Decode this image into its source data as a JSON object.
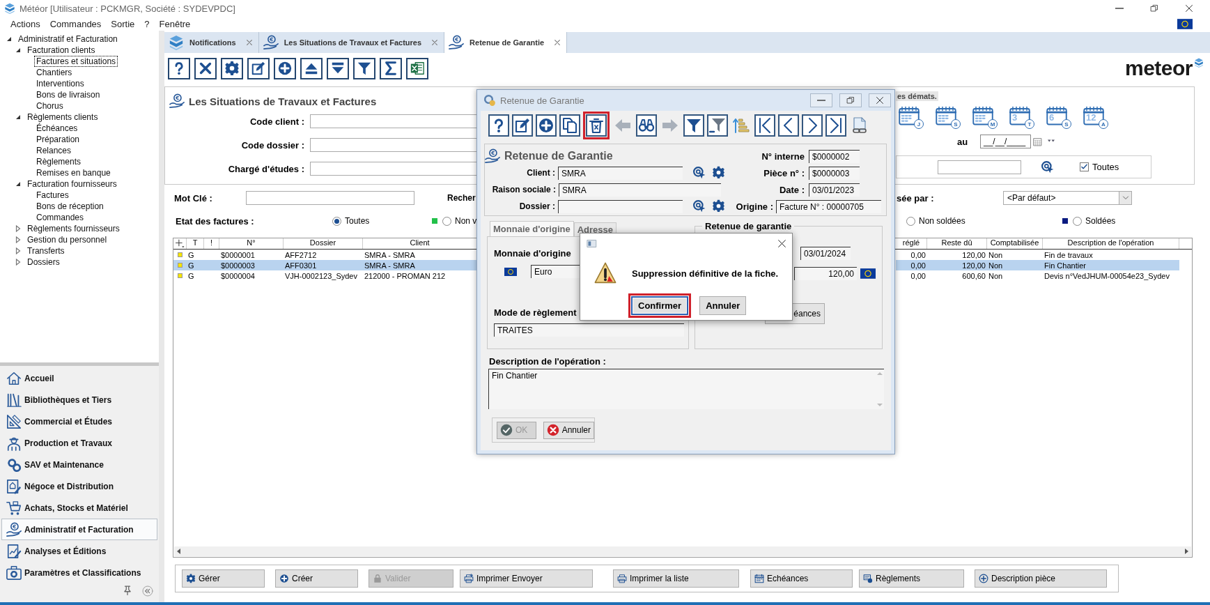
{
  "window": {
    "title": "Météor [Utilisateur : PCKMGR, Société : SYDEVPDC]"
  },
  "menu": [
    {
      "label": "Actions"
    },
    {
      "label": "Commandes"
    },
    {
      "label": "Sortie"
    },
    {
      "label": "?"
    },
    {
      "label": "Fenêtre"
    }
  ],
  "tree": [
    {
      "label": "Administratif et Facturation",
      "selected": false,
      "expanded": true,
      "children": [
        {
          "label": "Facturation clients",
          "selected": false,
          "expanded": true,
          "children": [
            {
              "label": "Factures et situations",
              "selected": true
            },
            {
              "label": "Chantiers",
              "selected": false
            },
            {
              "label": "Interventions",
              "selected": false
            },
            {
              "label": "Bons de livraison",
              "selected": false
            },
            {
              "label": "Chorus",
              "selected": false
            }
          ]
        },
        {
          "label": "Règlements clients",
          "selected": false,
          "expanded": true,
          "children": [
            {
              "label": "Échéances",
              "selected": false
            },
            {
              "label": "Préparation",
              "selected": false
            },
            {
              "label": "Relances",
              "selected": false
            },
            {
              "label": "Règlements",
              "selected": false
            },
            {
              "label": "Remises en banque",
              "selected": false
            }
          ]
        },
        {
          "label": "Facturation fournisseurs",
          "selected": false,
          "expanded": true,
          "children": [
            {
              "label": "Factures",
              "selected": false
            },
            {
              "label": "Bons de réception",
              "selected": false
            },
            {
              "label": "Commandes",
              "selected": false
            }
          ]
        },
        {
          "label": "Règlements fournisseurs",
          "selected": false,
          "expanded": false
        },
        {
          "label": "Gestion du personnel",
          "selected": false,
          "expanded": false
        },
        {
          "label": "Transferts",
          "selected": false,
          "expanded": false
        },
        {
          "label": "Dossiers",
          "selected": false,
          "expanded": false
        }
      ]
    }
  ],
  "modules": [
    {
      "label": "Accueil",
      "kind": "home",
      "selected": false
    },
    {
      "label": "Bibliothèques et Tiers",
      "kind": "library",
      "selected": false
    },
    {
      "label": "Commercial et Études",
      "kind": "drafting",
      "selected": false
    },
    {
      "label": "Production et Travaux",
      "kind": "worker",
      "selected": false
    },
    {
      "label": "SAV et Maintenance",
      "kind": "service",
      "selected": false
    },
    {
      "label": "Négoce et Distribution",
      "kind": "trade",
      "selected": false
    },
    {
      "label": "Achats, Stocks et Matériel",
      "kind": "cart",
      "selected": false
    },
    {
      "label": "Administratif et Facturation",
      "kind": "billing",
      "selected": true
    },
    {
      "label": "Analyses et Éditions",
      "kind": "analysis",
      "selected": false
    },
    {
      "label": "Paramètres et Classifications",
      "kind": "settings",
      "selected": false
    }
  ],
  "tabs": [
    {
      "label": "Notifications",
      "kind": "notifications",
      "selected": false
    },
    {
      "label": "Les Situations de Travaux et Factures",
      "kind": "billing",
      "selected": false
    },
    {
      "label": "Retenue de Garantie",
      "kind": "billing",
      "selected": true
    }
  ],
  "toolbar": [
    {
      "kind": "help"
    },
    {
      "kind": "close"
    },
    {
      "kind": "gear"
    },
    {
      "kind": "edit"
    },
    {
      "kind": "add"
    },
    {
      "kind": "up"
    },
    {
      "kind": "down"
    },
    {
      "kind": "filter"
    },
    {
      "kind": "sigma"
    },
    {
      "kind": "excel"
    }
  ],
  "logo": {
    "text": "meteor"
  },
  "search_panel": {
    "title": "Les Situations de Travaux et Factures",
    "fields": [
      {
        "label": "Code client :"
      },
      {
        "label": "Code dossier :"
      },
      {
        "label": "Chargé d'études :"
      }
    ]
  },
  "period_panel": {
    "tab_label": "es démats.",
    "periods": [
      {
        "badge": "J"
      },
      {
        "badge": "S"
      },
      {
        "badge": "M"
      },
      {
        "number": "3",
        "badge": "T"
      },
      {
        "number": "6",
        "badge": "S"
      },
      {
        "number": "12",
        "badge": "A"
      }
    ],
    "to_label": "au",
    "to_date": "__/__/____",
    "all": {
      "label": "Toutes",
      "checked": true
    }
  },
  "keyword": {
    "label": "Mot Clé :",
    "search_label": "Recher"
  },
  "sort": {
    "label": "sée par :",
    "value": "<Par défaut>"
  },
  "invoice_state": {
    "label": "Etat des factures :",
    "options": [
      {
        "label": "Toutes",
        "selected": true
      },
      {
        "label": "Non v",
        "selected": false,
        "color": "#22c04a"
      },
      {
        "label": "Non soldées",
        "selected": false
      },
      {
        "label": "Soldées",
        "selected": false,
        "color": "#0a1a80"
      }
    ]
  },
  "table": {
    "columns": [
      {
        "label": "T"
      },
      {
        "label": "!"
      },
      {
        "label": "N°"
      },
      {
        "label": "Dossier"
      },
      {
        "label": "Client"
      },
      {
        "label": "réglé"
      },
      {
        "label": "Reste dû"
      },
      {
        "label": "Comptabilisée"
      },
      {
        "label": "Description de l'opération"
      }
    ],
    "rows": [
      {
        "selected": false,
        "color": "#f5e400",
        "type": "G",
        "number": "$0000001",
        "file": "AFF2712",
        "client": "SMRA - SMRA",
        "paid": "0,00",
        "remaining": "120,00",
        "accounted": "Non",
        "description": "Fin de travaux"
      },
      {
        "selected": true,
        "color": "#f5e400",
        "type": "G",
        "number": "$0000003",
        "file": "AFF0301",
        "client": "SMRA - SMRA",
        "paid": "0,00",
        "remaining": "120,00",
        "accounted": "Non",
        "description": "Fin Chantier"
      },
      {
        "selected": false,
        "color": "#f5e400",
        "type": "G",
        "number": "$0000004",
        "file": "VJH-0002123_Sydev",
        "client": "212000 - PROMAN 212",
        "paid": "0,00",
        "remaining": "600,60",
        "accounted": "Non",
        "description": "Devis n°VedJHUM-00054e23_Sydev"
      }
    ]
  },
  "actions": [
    {
      "label": "Gérer",
      "kind": "gear",
      "disabled": false
    },
    {
      "label": "Créer",
      "kind": "add",
      "disabled": false
    },
    {
      "label": "Valider",
      "kind": "lock",
      "disabled": true
    },
    {
      "label": "Imprimer Envoyer",
      "kind": "print_send",
      "disabled": false
    },
    {
      "label": "Imprimer la liste",
      "kind": "print",
      "disabled": false
    },
    {
      "label": "Echéances",
      "kind": "calendar",
      "disabled": false
    },
    {
      "label": "Règlements",
      "kind": "payment",
      "disabled": false
    },
    {
      "label": "Description pièce",
      "kind": "add_outline",
      "disabled": false
    }
  ],
  "dialog": {
    "title": "Retenue de Garantie",
    "toolbar": [
      {
        "kind": "help",
        "highlighted": false
      },
      {
        "kind": "edit",
        "highlighted": false
      },
      {
        "kind": "add",
        "highlighted": false
      },
      {
        "kind": "copy",
        "highlighted": false
      },
      {
        "kind": "delete",
        "highlighted": true
      },
      {
        "kind": "back",
        "highlighted": false
      },
      {
        "kind": "find",
        "highlighted": false
      },
      {
        "kind": "forward",
        "highlighted": false
      },
      {
        "kind": "filter",
        "highlighted": false
      },
      {
        "kind": "filter_remove",
        "highlighted": false
      },
      {
        "kind": "sort",
        "highlighted": false
      },
      {
        "kind": "first",
        "highlighted": false
      },
      {
        "kind": "prev",
        "highlighted": false
      },
      {
        "kind": "next",
        "highlighted": false
      },
      {
        "kind": "last",
        "highlighted": false
      },
      {
        "kind": "doclink",
        "highlighted": false
      }
    ],
    "heading": "Retenue de Garantie",
    "party": [
      {
        "label": "Client :",
        "value": "SMRA",
        "lookup": true
      },
      {
        "label": "Raison sociale :",
        "value": "SMRA",
        "lookup": false
      },
      {
        "label": "Dossier :",
        "lookup": true
      }
    ],
    "info": [
      {
        "label": "N° interne",
        "value": "$0000002"
      },
      {
        "label": "Pièce n° :",
        "value": "$0000003"
      },
      {
        "label": "Date :",
        "value": "03/01/2023"
      },
      {
        "label": "Origine :",
        "value": "Facture N° : 00000705"
      }
    ],
    "tabs": [
      {
        "label": "Monnaie d'origine",
        "selected": true
      },
      {
        "label": "Adresse",
        "selected": false
      }
    ],
    "currency": {
      "label": "Monnaie d'origine",
      "value": "Euro"
    },
    "payment_mode": {
      "label": "Mode de règlement",
      "value": "TRAITES"
    },
    "retention": {
      "title": "Retenue de garantie",
      "date": "03/01/2024",
      "amount": "120,00",
      "schedule_button": "éances"
    },
    "description": {
      "label": "Description de l'opération :",
      "value": "Fin Chantier"
    },
    "buttons": [
      {
        "label": "OK",
        "kind": "ok",
        "disabled": true
      },
      {
        "label": "Annuler",
        "kind": "cancel",
        "disabled": false
      }
    ]
  },
  "message_box": {
    "message": "Suppression définitive de la fiche.",
    "buttons": [
      {
        "label": "Confirmer",
        "focused": true,
        "highlighted": true
      },
      {
        "label": "Annuler",
        "focused": false,
        "highlighted": false
      }
    ]
  }
}
